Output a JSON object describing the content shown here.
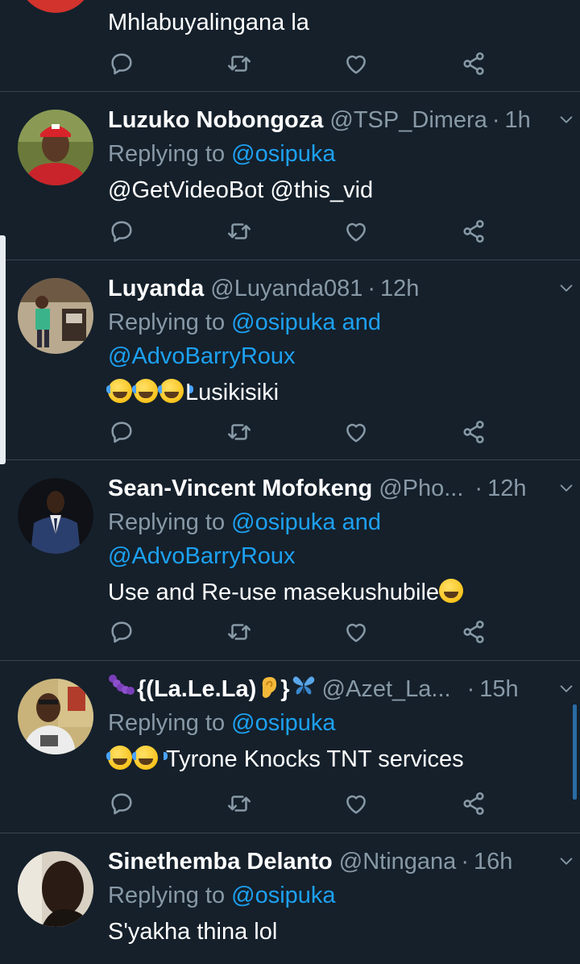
{
  "colors": {
    "background": "#15202b",
    "divider": "#38444d",
    "muted": "#8899a6",
    "link": "#1da1f2"
  },
  "partial_tweet": {
    "text": "Mhlabuyalingana la"
  },
  "tweets": [
    {
      "name": "Luzuko Nobongoza",
      "handle": "@TSP_Dimera",
      "time": "1h",
      "replying_prefix": "Replying to ",
      "replying_to": "@osipuka",
      "replying_line2": "",
      "text": "@GetVideoBot @this_vid",
      "avatar": "red-cap-man-avatar"
    },
    {
      "name": "Luyanda",
      "handle": "@Luyanda081",
      "time": "12h",
      "replying_prefix": "Replying to ",
      "replying_to": "@osipuka and",
      "replying_line2": "@AdvoBarryRoux",
      "text": "Lusikisiki",
      "avatar": "room-photo-avatar"
    },
    {
      "name": "Sean-Vincent Mofokeng",
      "handle": "@Pho...",
      "time": "12h",
      "replying_prefix": "Replying to ",
      "replying_to": "@osipuka and",
      "replying_line2": "@AdvoBarryRoux",
      "text": "Use and Re-use masekushubile",
      "avatar": "suit-man-avatar"
    },
    {
      "name": "{(La.Le.La)",
      "name_suffix": "}",
      "handle": "@Azet_La...",
      "time": "15h",
      "replying_prefix": "Replying to ",
      "replying_to": "@osipuka",
      "replying_line2": "",
      "text": "Tyrone Knocks TNT services",
      "avatar": "selfie-man-avatar"
    },
    {
      "name": "Sinethemba Delanto",
      "handle": "@Ntingana",
      "time": "16h",
      "replying_prefix": "Replying to ",
      "replying_to": "@osipuka",
      "replying_line2": "",
      "text": "S'yakha thina lol",
      "avatar": "dark-portrait-avatar"
    }
  ],
  "separator_dot": "·"
}
